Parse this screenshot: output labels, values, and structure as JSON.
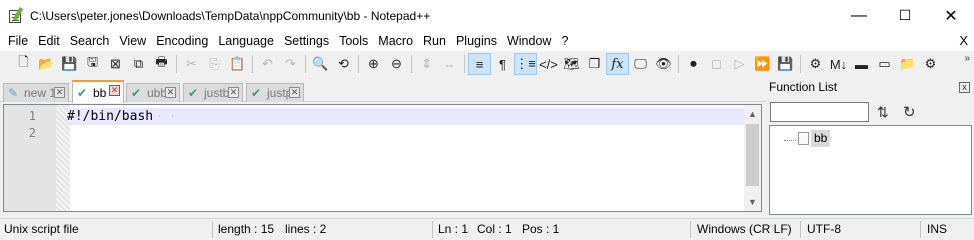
{
  "window": {
    "title": "C:\\Users\\peter.jones\\Downloads\\TempData\\nppCommunity\\bb - Notepad++",
    "minimize": "—",
    "maximize": "☐",
    "close": "✕"
  },
  "menu": {
    "items": [
      "File",
      "Edit",
      "Search",
      "View",
      "Encoding",
      "Language",
      "Settings",
      "Tools",
      "Macro",
      "Run",
      "Plugins",
      "Window",
      "?"
    ],
    "close_glyph": "X"
  },
  "toolbar": {
    "overflow": "»",
    "icons": [
      {
        "name": "new-file",
        "glyph": "🗋"
      },
      {
        "name": "open-file",
        "glyph": "📂"
      },
      {
        "name": "save",
        "glyph": "💾",
        "dim": true
      },
      {
        "name": "save-all",
        "glyph": "🖫"
      },
      {
        "name": "close",
        "glyph": "⊠"
      },
      {
        "name": "close-all",
        "glyph": "⧉"
      },
      {
        "name": "print",
        "glyph": "🖶"
      },
      {
        "name": "cut",
        "glyph": "✂",
        "dim": true
      },
      {
        "name": "copy",
        "glyph": "⎘",
        "dim": true
      },
      {
        "name": "paste",
        "glyph": "📋"
      },
      {
        "name": "undo",
        "glyph": "↶",
        "dim": true
      },
      {
        "name": "redo",
        "glyph": "↷",
        "dim": true
      },
      {
        "name": "find",
        "glyph": "🔍"
      },
      {
        "name": "replace",
        "glyph": "⟲"
      },
      {
        "name": "zoom-in",
        "glyph": "⊕"
      },
      {
        "name": "zoom-out",
        "glyph": "⊖"
      },
      {
        "name": "sync-vertical",
        "glyph": "⇕",
        "dim": true
      },
      {
        "name": "sync-horizontal",
        "glyph": "⇔",
        "dim": true
      },
      {
        "name": "word-wrap",
        "glyph": "≡",
        "on": true
      },
      {
        "name": "show-all-chars",
        "glyph": "¶"
      },
      {
        "name": "indent-guide",
        "glyph": "⋮≡",
        "on": true
      },
      {
        "name": "xml-tag",
        "glyph": "</>"
      },
      {
        "name": "document-map",
        "glyph": "🗺"
      },
      {
        "name": "document-list",
        "glyph": "❐"
      },
      {
        "name": "function-list",
        "glyph": "fx",
        "on": true
      },
      {
        "name": "folder-as-workspace",
        "glyph": "🖵"
      },
      {
        "name": "monitoring",
        "glyph": "👁"
      },
      {
        "name": "record-macro",
        "glyph": "⏺"
      },
      {
        "name": "stop-recording",
        "glyph": "◻",
        "dim": true
      },
      {
        "name": "playback-macro",
        "glyph": "▷",
        "dim": true
      },
      {
        "name": "run-macro-multiple",
        "glyph": "⏩"
      },
      {
        "name": "save-macro",
        "glyph": "💾",
        "dim": true
      },
      {
        "name": "plugin-1",
        "glyph": "⚙"
      },
      {
        "name": "markdown",
        "glyph": "M↓"
      },
      {
        "name": "plugin-3",
        "glyph": "▬"
      },
      {
        "name": "plugin-4",
        "glyph": "▭"
      },
      {
        "name": "plugin-5",
        "glyph": "📁"
      },
      {
        "name": "plugin-6",
        "glyph": "⚙"
      }
    ]
  },
  "tabs": [
    {
      "label": "new 1",
      "state": "unsaved",
      "active": false
    },
    {
      "label": "bb",
      "state": "saved",
      "active": true
    },
    {
      "label": "ubb",
      "state": "saved",
      "active": false
    },
    {
      "label": "justb",
      "state": "saved",
      "active": false
    },
    {
      "label": "justp",
      "state": "saved",
      "active": false
    }
  ],
  "editor": {
    "lines": [
      "#!/bin/bash",
      ""
    ],
    "line_numbers": [
      "1",
      "2"
    ],
    "eol_marker": "· ·",
    "scroll_up": "▲",
    "scroll_down": "▼"
  },
  "function_list": {
    "title": "Function List",
    "close": "x",
    "search_placeholder": "",
    "sort_icon": "⇅",
    "reload_icon": "↻",
    "tree_root": "bb"
  },
  "status": {
    "file_type": "Unix script file",
    "length": "length : 15",
    "lines": "lines : 2",
    "ln": "Ln : 1",
    "col": "Col : 1",
    "pos": "Pos : 1",
    "eol": "Windows (CR LF)",
    "encoding": "UTF-8",
    "mode": "INS"
  }
}
